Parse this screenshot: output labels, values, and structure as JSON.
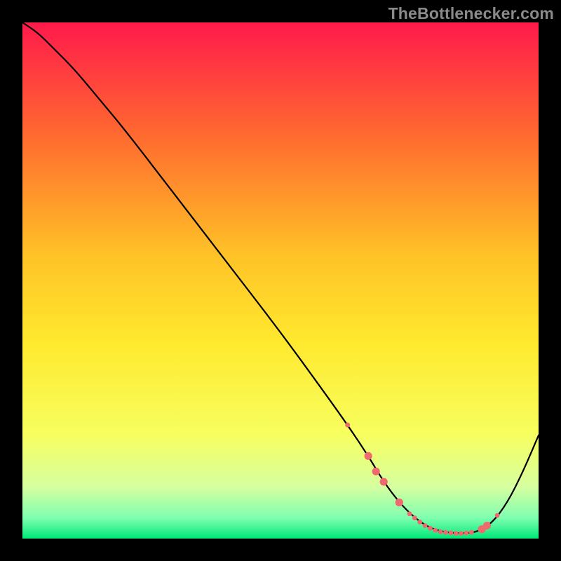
{
  "watermark": "TheBottlenecker.com",
  "chart_data": {
    "type": "line",
    "title": "",
    "xlabel": "",
    "ylabel": "",
    "xlim": [
      0,
      100
    ],
    "ylim": [
      0,
      100
    ],
    "background_gradient": {
      "stops": [
        {
          "offset": 0.0,
          "color": "#ff1a4b"
        },
        {
          "offset": 0.22,
          "color": "#ff6a2f"
        },
        {
          "offset": 0.45,
          "color": "#ffc227"
        },
        {
          "offset": 0.62,
          "color": "#ffe92e"
        },
        {
          "offset": 0.8,
          "color": "#f7ff60"
        },
        {
          "offset": 0.9,
          "color": "#d6ffa0"
        },
        {
          "offset": 0.96,
          "color": "#7fffb0"
        },
        {
          "offset": 1.0,
          "color": "#00e878"
        }
      ]
    },
    "series": [
      {
        "name": "curve",
        "color": "#000000",
        "stroke_width": 2.2,
        "x": [
          0,
          3,
          6,
          10,
          15,
          20,
          30,
          40,
          50,
          58,
          63,
          67,
          70,
          73,
          76,
          79,
          82,
          85,
          88,
          91,
          94,
          97,
          100
        ],
        "y": [
          100,
          98,
          95,
          91,
          85,
          79,
          66,
          53,
          40,
          29,
          22,
          16,
          11,
          7,
          4,
          2,
          1.2,
          1.0,
          1.2,
          3,
          7,
          13,
          20
        ]
      }
    ],
    "markers": {
      "color": "#ef6a6f",
      "radius_small": 3.4,
      "radius_large": 5.6,
      "points": [
        {
          "x": 63.0,
          "y": 22.0,
          "size": "small"
        },
        {
          "x": 67.0,
          "y": 16.0,
          "size": "large"
        },
        {
          "x": 68.5,
          "y": 13.0,
          "size": "large"
        },
        {
          "x": 70.0,
          "y": 11.0,
          "size": "large"
        },
        {
          "x": 73.0,
          "y": 7.0,
          "size": "large"
        },
        {
          "x": 75.0,
          "y": 4.8,
          "size": "small"
        },
        {
          "x": 76.0,
          "y": 4.0,
          "size": "small"
        },
        {
          "x": 77.0,
          "y": 3.2,
          "size": "small"
        },
        {
          "x": 78.0,
          "y": 2.5,
          "size": "small"
        },
        {
          "x": 79.0,
          "y": 2.0,
          "size": "small"
        },
        {
          "x": 80.0,
          "y": 1.6,
          "size": "small"
        },
        {
          "x": 81.0,
          "y": 1.3,
          "size": "small"
        },
        {
          "x": 82.0,
          "y": 1.2,
          "size": "small"
        },
        {
          "x": 83.0,
          "y": 1.1,
          "size": "small"
        },
        {
          "x": 84.0,
          "y": 1.0,
          "size": "small"
        },
        {
          "x": 85.0,
          "y": 1.0,
          "size": "small"
        },
        {
          "x": 86.0,
          "y": 1.1,
          "size": "small"
        },
        {
          "x": 87.0,
          "y": 1.2,
          "size": "small"
        },
        {
          "x": 89.0,
          "y": 1.8,
          "size": "large"
        },
        {
          "x": 90.0,
          "y": 2.5,
          "size": "large"
        },
        {
          "x": 92.0,
          "y": 4.5,
          "size": "small"
        }
      ]
    }
  }
}
